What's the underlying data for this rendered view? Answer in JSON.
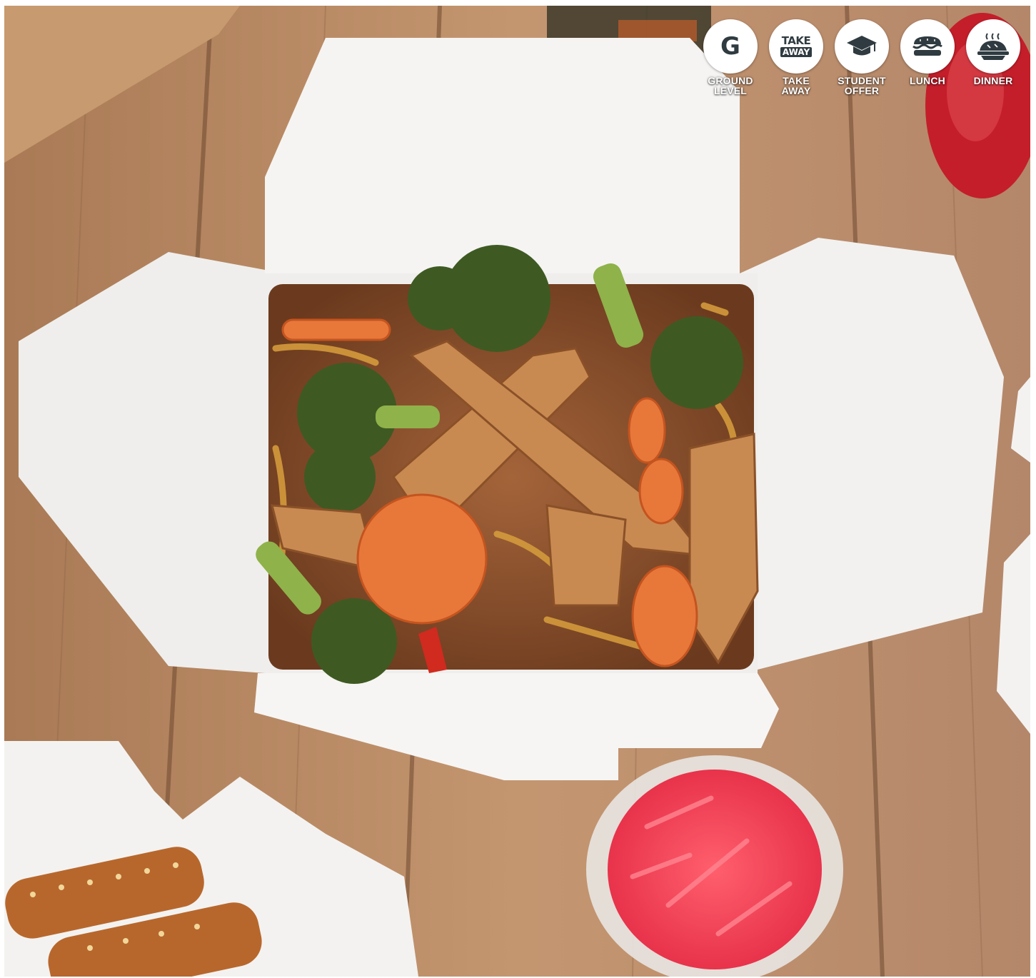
{
  "badges": [
    {
      "id": "ground-level",
      "icon": "letter-g-icon",
      "glyph": "G",
      "label_lines": [
        "GROUND",
        "LEVEL"
      ]
    },
    {
      "id": "take-away",
      "icon": "take-away-icon",
      "glyph_lines": [
        "TAKE",
        "AWAY"
      ],
      "label_lines": [
        "TAKE",
        "AWAY"
      ]
    },
    {
      "id": "student-offer",
      "icon": "graduation-cap-icon",
      "label_lines": [
        "STUDENT",
        "OFFER"
      ]
    },
    {
      "id": "lunch",
      "icon": "sandwich-icon",
      "label_lines": [
        "LUNCH"
      ]
    },
    {
      "id": "dinner",
      "icon": "pie-icon",
      "label_lines": [
        "DINNER"
      ]
    }
  ],
  "colors": {
    "badge_bg": "#ffffff",
    "badge_icon": "#2f3b40",
    "badge_label": "#ffffff",
    "table_wood": "#b88862",
    "box_white": "#f4f3f1"
  }
}
